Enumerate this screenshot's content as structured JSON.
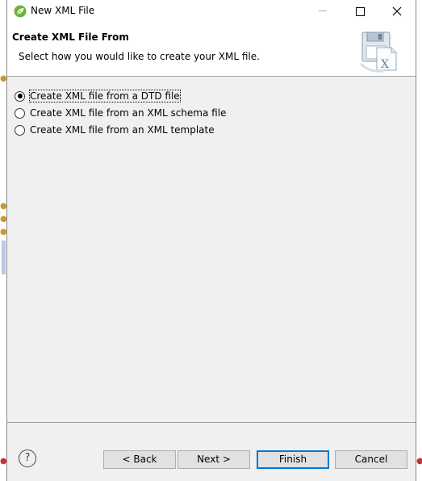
{
  "window": {
    "title": "New XML File",
    "app_icon": "spring-leaf-icon",
    "controls": {
      "minimize": "minimize-icon",
      "maximize": "maximize-icon",
      "close": "close-icon"
    }
  },
  "header": {
    "title": "Create XML File From",
    "description": "Select how you would like to create your XML file.",
    "icon": "xml-file-save-icon"
  },
  "options": [
    {
      "label": "Create XML file from a DTD file",
      "selected": true
    },
    {
      "label": "Create XML file from an XML schema file",
      "selected": false
    },
    {
      "label": "Create XML file from an XML template",
      "selected": false
    }
  ],
  "buttons": {
    "help": "?",
    "back": "< Back",
    "next": "Next >",
    "finish": "Finish",
    "cancel": "Cancel"
  },
  "colors": {
    "dialog_bg": "#f0f0f0",
    "header_bg": "#ffffff",
    "default_button_border": "#0078d7",
    "leaf_green": "#6db33f"
  }
}
